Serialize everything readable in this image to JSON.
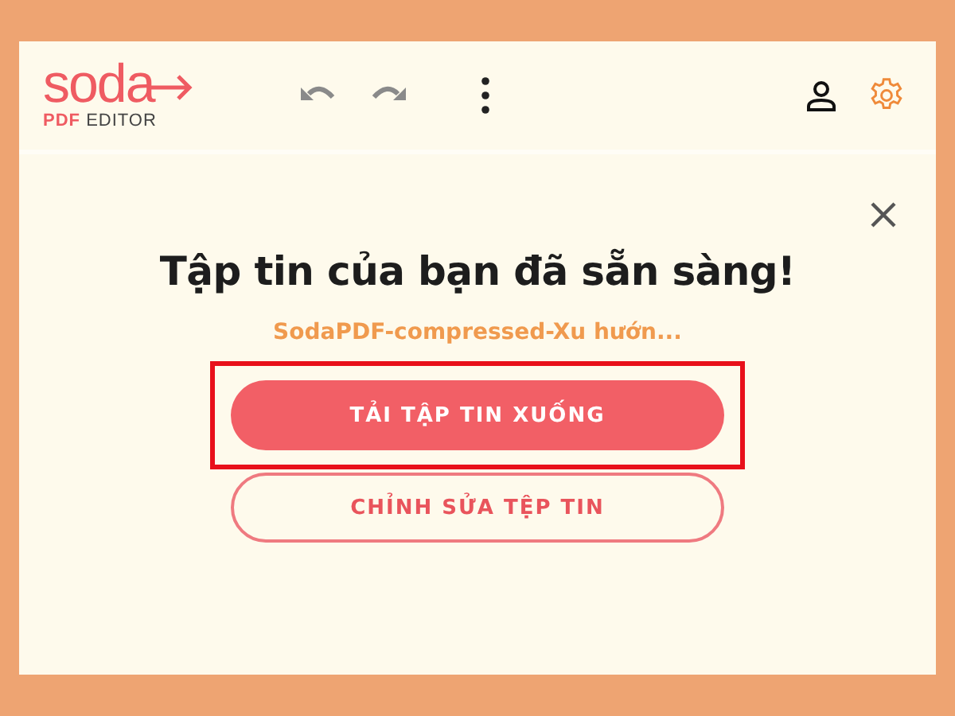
{
  "logo": {
    "word": "soda",
    "sub_bold": "PDF",
    "sub": "EDITOR"
  },
  "dialog": {
    "title": "Tập tin của bạn đã sẵn sàng!",
    "filename": "SodaPDF-compressed-Xu hướn...",
    "buttons": [
      {
        "label": "TẢI TẬP TIN XUỐNG",
        "kind": "primary",
        "highlighted": true
      },
      {
        "label": "CHỈNH SỬA TỆP TIN",
        "kind": "outline",
        "highlighted": false
      }
    ]
  }
}
